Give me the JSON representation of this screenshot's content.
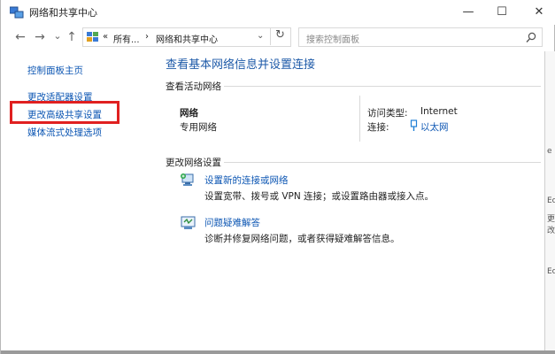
{
  "window": {
    "title": "网络和共享中心",
    "min": "—",
    "max": "☐",
    "close": "✕"
  },
  "nav": {
    "back": "←",
    "forward": "→",
    "recent": "⌄",
    "up": "↑",
    "breadcrumb_overflow": "«",
    "breadcrumb_1": "所有...",
    "breadcrumb_sep": "›",
    "breadcrumb_2": "网络和共享中心",
    "dropdown": "⌄",
    "refresh": "↻",
    "search_placeholder": "搜索控制面板"
  },
  "sidebar": {
    "items": [
      {
        "label": "控制面板主页"
      },
      {
        "label": "更改适配器设置"
      },
      {
        "label": "更改高级共享设置"
      },
      {
        "label": "媒体流式处理选项"
      }
    ]
  },
  "main": {
    "title": "查看基本网络信息并设置连接",
    "active_networks_heading": "查看活动网络",
    "network_name": "网络",
    "network_type": "专用网络",
    "access_type_label": "访问类型:",
    "access_type_value": "Internet",
    "connections_label": "连接:",
    "connections_value": "以太网",
    "change_settings_heading": "更改网络设置",
    "tasks": [
      {
        "title": "设置新的连接或网络",
        "desc": "设置宽带、拨号或 VPN 连接；或设置路由器或接入点。"
      },
      {
        "title": "问题疑难解答",
        "desc": "诊断并修复网络问题，或者获得疑难解答信息。"
      }
    ]
  },
  "colors": {
    "link": "#0c56b3",
    "title": "#1e5aa8",
    "highlight": "#e02020"
  },
  "right_strip": [
    "e",
    "Ec",
    "更改",
    "Ec"
  ]
}
